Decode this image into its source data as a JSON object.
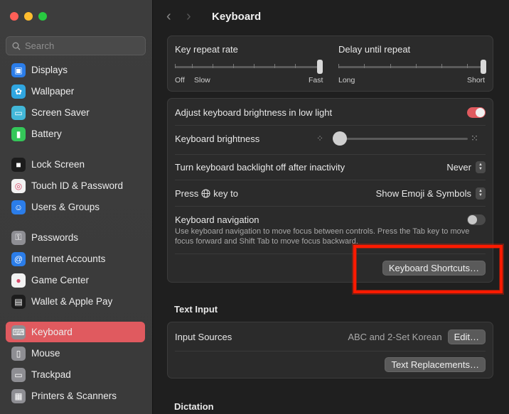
{
  "sidebar": {
    "search_placeholder": "Search",
    "items": [
      {
        "label": "Displays",
        "icon": "displays-icon",
        "color": "#2b7de9"
      },
      {
        "label": "Wallpaper",
        "icon": "wallpaper-icon",
        "color": "#30a6e0"
      },
      {
        "label": "Screen Saver",
        "icon": "screen-saver-icon",
        "color": "#42b7d8"
      },
      {
        "label": "Battery",
        "icon": "battery-icon",
        "color": "#34c759"
      },
      {
        "label": "Lock Screen",
        "icon": "lock-icon",
        "color": "#1c1c1c"
      },
      {
        "label": "Touch ID & Password",
        "icon": "fingerprint-icon",
        "color": "#f2f2f2"
      },
      {
        "label": "Users & Groups",
        "icon": "users-icon",
        "color": "#2b7de9"
      },
      {
        "label": "Passwords",
        "icon": "key-icon",
        "color": "#8e8e93"
      },
      {
        "label": "Internet Accounts",
        "icon": "at-icon",
        "color": "#2b7de9"
      },
      {
        "label": "Game Center",
        "icon": "game-center-icon",
        "color": "#f2f2f2"
      },
      {
        "label": "Wallet & Apple Pay",
        "icon": "wallet-icon",
        "color": "#1c1c1c"
      },
      {
        "label": "Keyboard",
        "icon": "keyboard-icon",
        "color": "#8e8e93",
        "active": true
      },
      {
        "label": "Mouse",
        "icon": "mouse-icon",
        "color": "#8e8e93"
      },
      {
        "label": "Trackpad",
        "icon": "trackpad-icon",
        "color": "#8e8e93"
      },
      {
        "label": "Printers & Scanners",
        "icon": "printer-icon",
        "color": "#8e8e93"
      }
    ]
  },
  "header": {
    "title": "Keyboard"
  },
  "repeat": {
    "key_repeat_label": "Key repeat rate",
    "key_repeat_off": "Off",
    "key_repeat_slow": "Slow",
    "key_repeat_fast": "Fast",
    "delay_label": "Delay until repeat",
    "delay_long": "Long",
    "delay_short": "Short"
  },
  "settings": {
    "adjust_brightness_label": "Adjust keyboard brightness in low light",
    "brightness_label": "Keyboard brightness",
    "backlight_off_label": "Turn keyboard backlight off after inactivity",
    "backlight_off_value": "Never",
    "press_key_label_before": "Press",
    "press_key_label_after": "key to",
    "press_key_value": "Show Emoji & Symbols",
    "keyboard_nav_label": "Keyboard navigation",
    "keyboard_nav_desc": "Use keyboard navigation to move focus between controls. Press the Tab key to move focus forward and Shift Tab to move focus backward.",
    "shortcuts_button": "Keyboard Shortcuts…"
  },
  "text_input": {
    "section_title": "Text Input",
    "input_sources_label": "Input Sources",
    "input_sources_value": "ABC and 2-Set Korean",
    "edit_button": "Edit…",
    "text_replacements_button": "Text Replacements…"
  },
  "dictation": {
    "section_title": "Dictation"
  }
}
